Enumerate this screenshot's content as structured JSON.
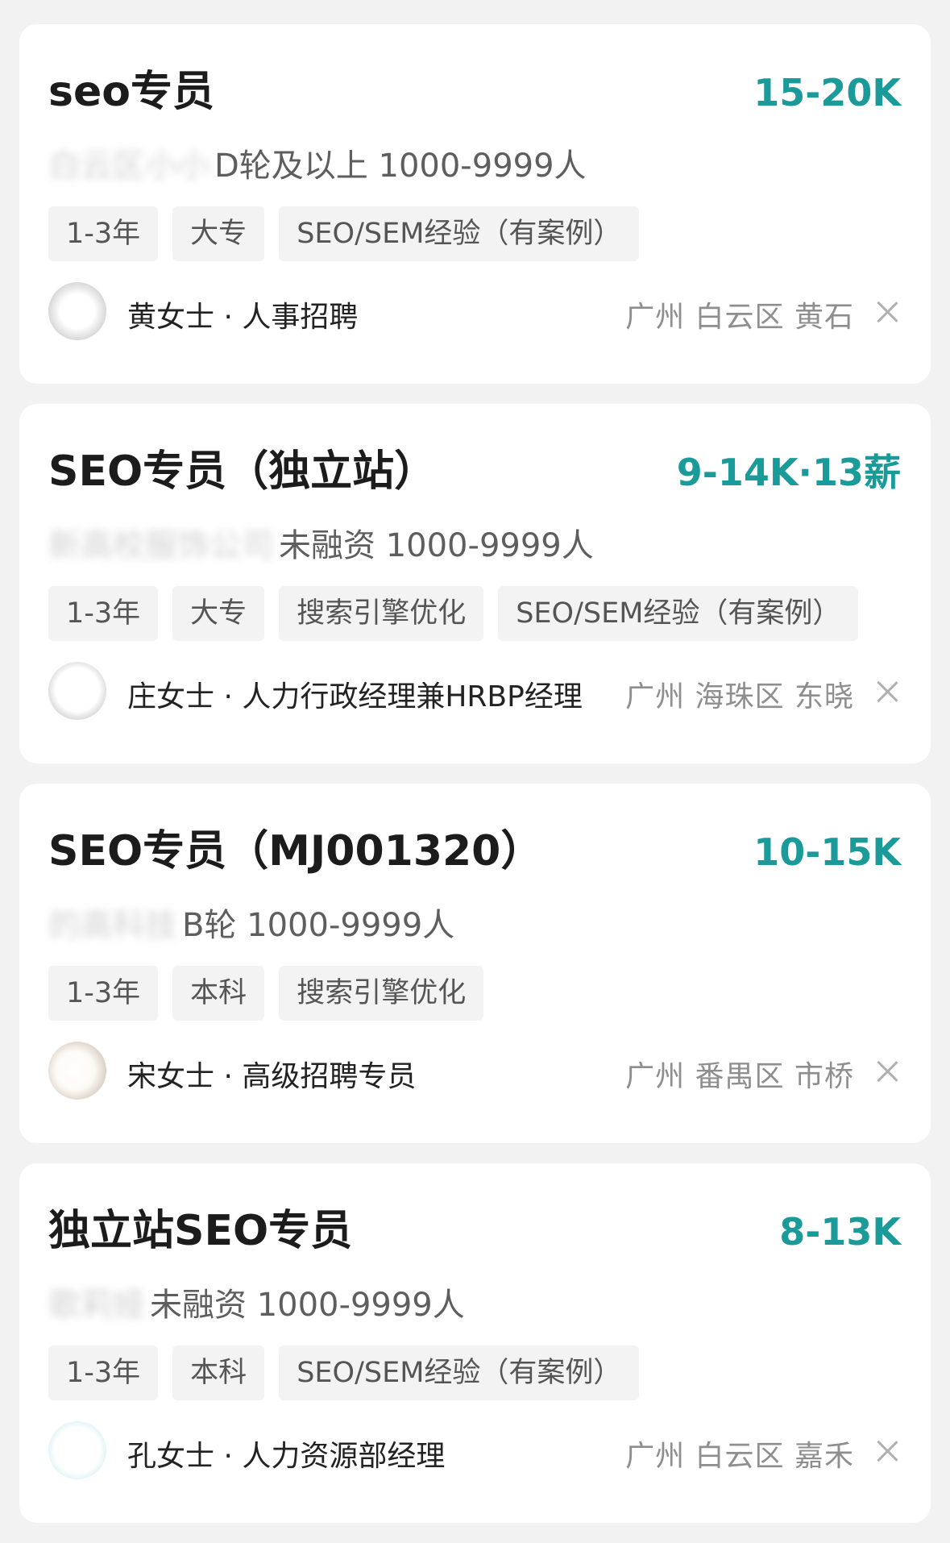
{
  "jobs": [
    {
      "title": "seo专员",
      "salary": "15-20K",
      "company_name": "白云区小小",
      "company_meta": "D轮及以上 1000-9999人",
      "tags": [
        "1-3年",
        "大专",
        "SEO/SEM经验（有案例）"
      ],
      "recruiter": "黄女士 · 人事招聘",
      "location": "广州 白云区 黄石"
    },
    {
      "title": "SEO专员（独立站）",
      "salary": "9-14K·13薪",
      "company_name": "新高校服饰公司",
      "company_meta": "未融资 1000-9999人",
      "tags": [
        "1-3年",
        "大专",
        "搜索引擎优化",
        "SEO/SEM经验（有案例）"
      ],
      "recruiter": "庄女士 · 人力行政经理兼HRBP经理",
      "location": "广州 海珠区 东晓"
    },
    {
      "title": "SEO专员（MJ001320）",
      "salary": "10-15K",
      "company_name": "的高科技",
      "company_meta": "B轮 1000-9999人",
      "tags": [
        "1-3年",
        "本科",
        "搜索引擎优化"
      ],
      "recruiter": "宋女士 · 高级招聘专员",
      "location": "广州 番禺区 市桥"
    },
    {
      "title": "独立站SEO专员",
      "salary": "8-13K",
      "company_name": "歌莉娅",
      "company_meta": "未融资 1000-9999人",
      "tags": [
        "1-3年",
        "本科",
        "SEO/SEM经验（有案例）"
      ],
      "recruiter": "孔女士 · 人力资源部经理",
      "location": "广州 白云区 嘉禾"
    }
  ]
}
